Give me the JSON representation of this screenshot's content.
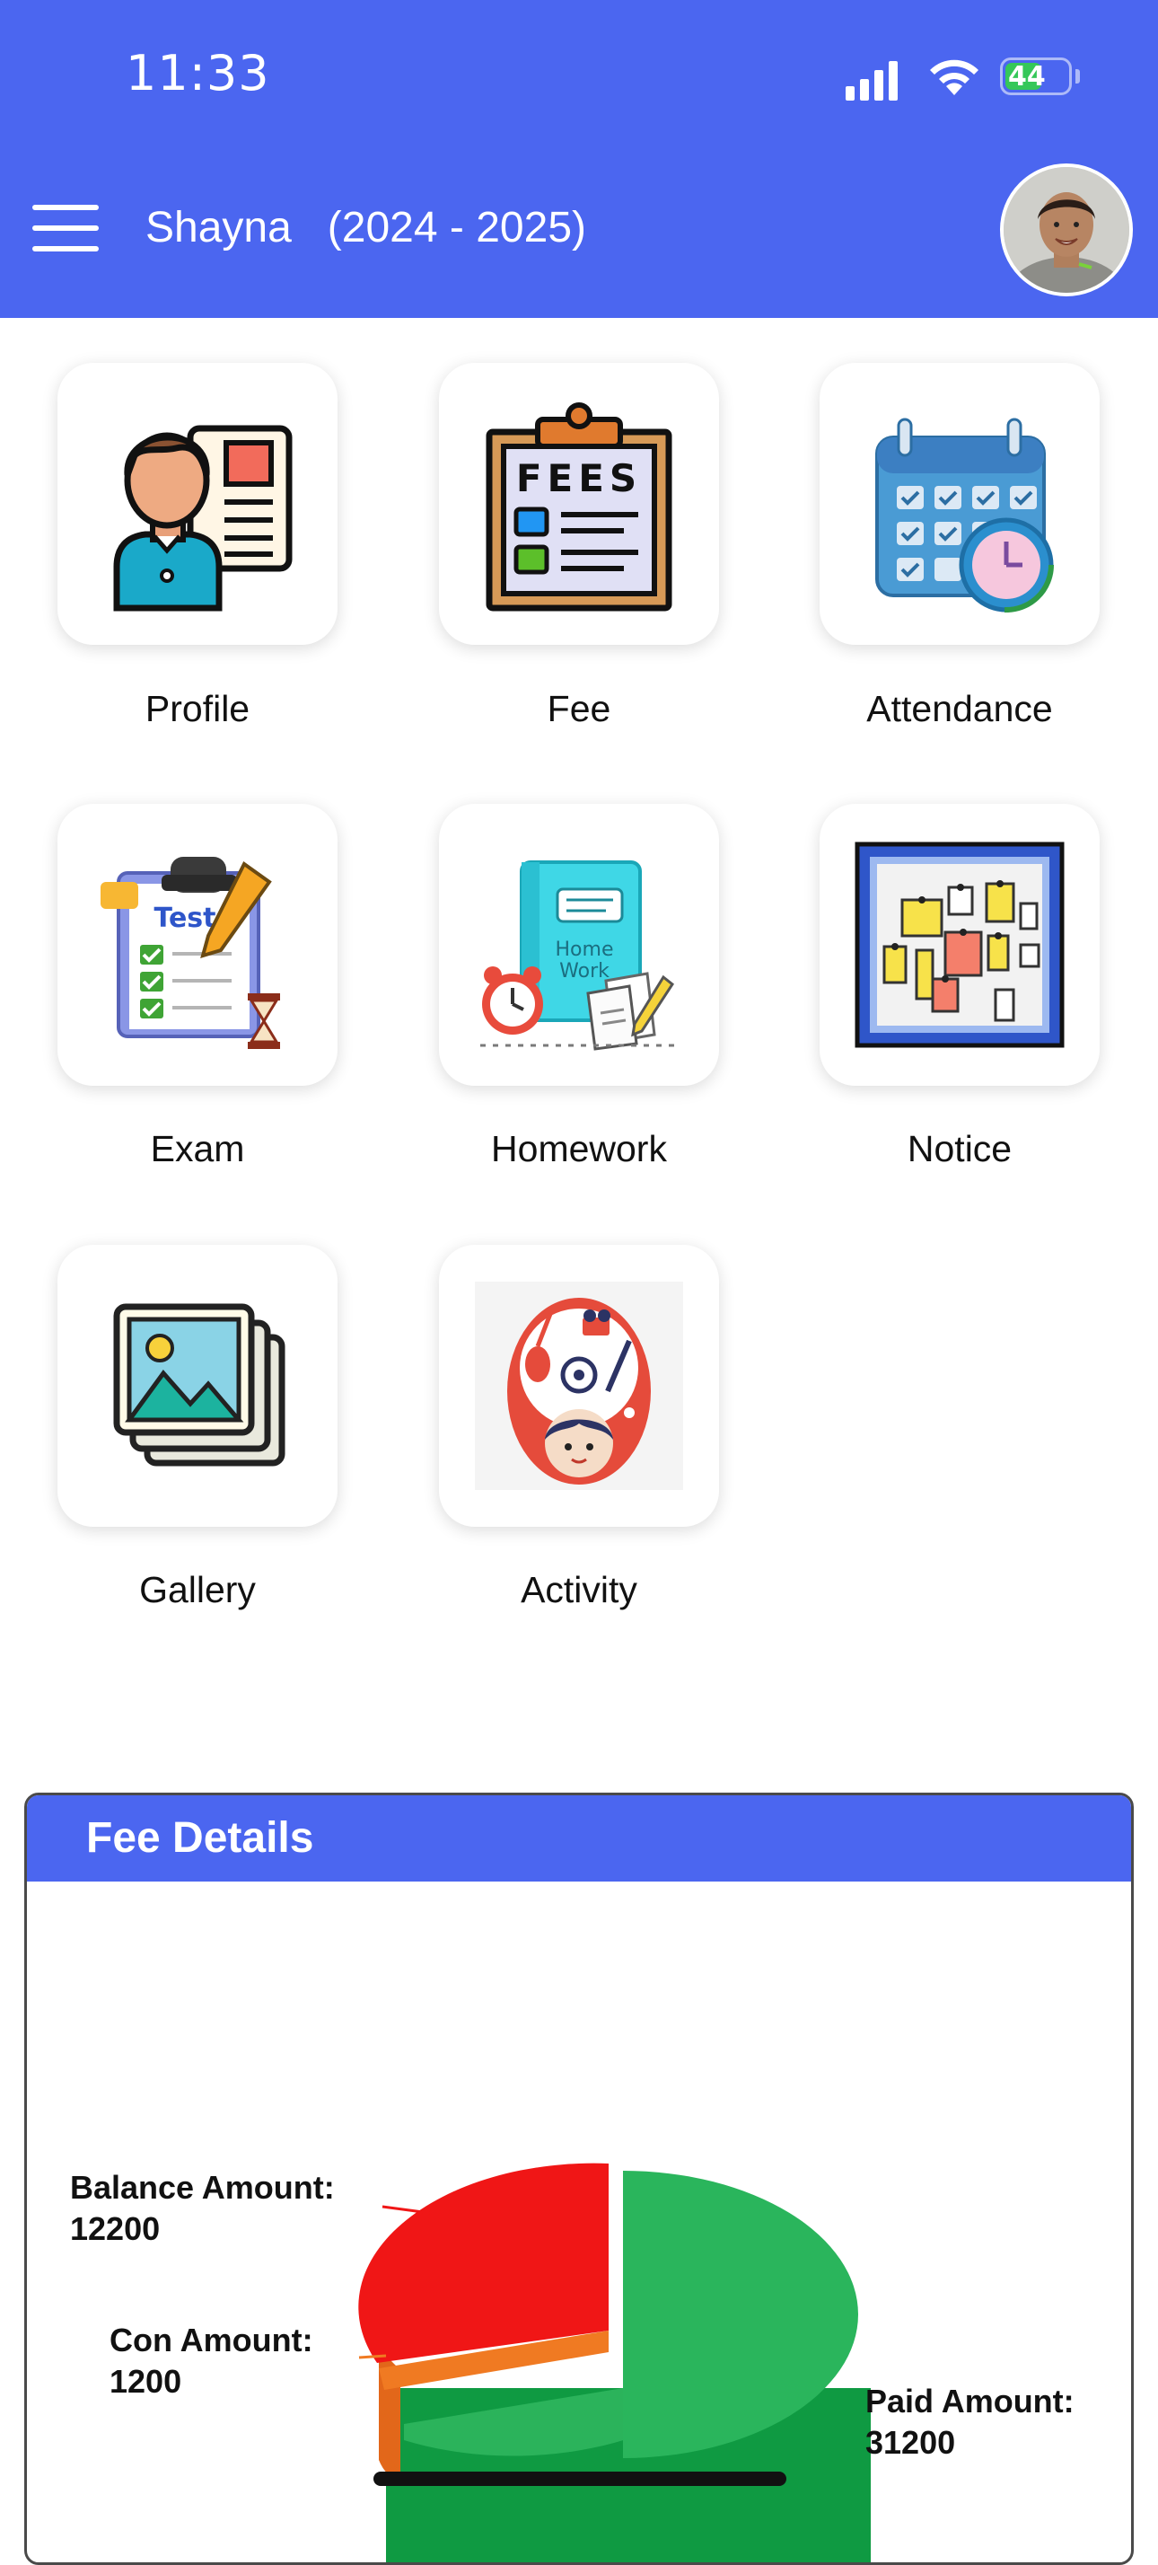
{
  "status_bar": {
    "time": "11:33",
    "battery": "44"
  },
  "header": {
    "title": "Shayna   (2024 - 2025)"
  },
  "tiles": [
    {
      "label": "Profile",
      "icon": "profile-icon"
    },
    {
      "label": "Fee",
      "icon": "fees-clipboard-icon",
      "icon_text": "FEES"
    },
    {
      "label": "Attendance",
      "icon": "calendar-clock-icon"
    },
    {
      "label": "Exam",
      "icon": "test-clipboard-icon",
      "icon_text": "Test"
    },
    {
      "label": "Homework",
      "icon": "homework-book-icon",
      "icon_text_1": "Home",
      "icon_text_2": "Work"
    },
    {
      "label": "Notice",
      "icon": "notice-board-icon"
    },
    {
      "label": "Gallery",
      "icon": "gallery-photos-icon"
    },
    {
      "label": "Activity",
      "icon": "activity-icon"
    }
  ],
  "fee_details": {
    "title": "Fee Details",
    "chart_data": {
      "type": "pie",
      "title": "",
      "slices": [
        {
          "name": "Paid Amount",
          "value": 31200,
          "color": "#2bb35b"
        },
        {
          "name": "Con Amount",
          "value": 1200,
          "color": "#f07a22"
        },
        {
          "name": "Balance Amount",
          "value": 12200,
          "color": "#f01616"
        }
      ],
      "labels": [
        {
          "line1": "Balance Amount:",
          "line2": "12200"
        },
        {
          "line1": "Con Amount:",
          "line2": "1200"
        },
        {
          "line1": "Paid Amount:",
          "line2": "31200"
        }
      ]
    }
  },
  "colors": {
    "primary": "#4b66f0",
    "paid": "#2bb35b",
    "concession": "#f07a22",
    "balance": "#f01616"
  }
}
